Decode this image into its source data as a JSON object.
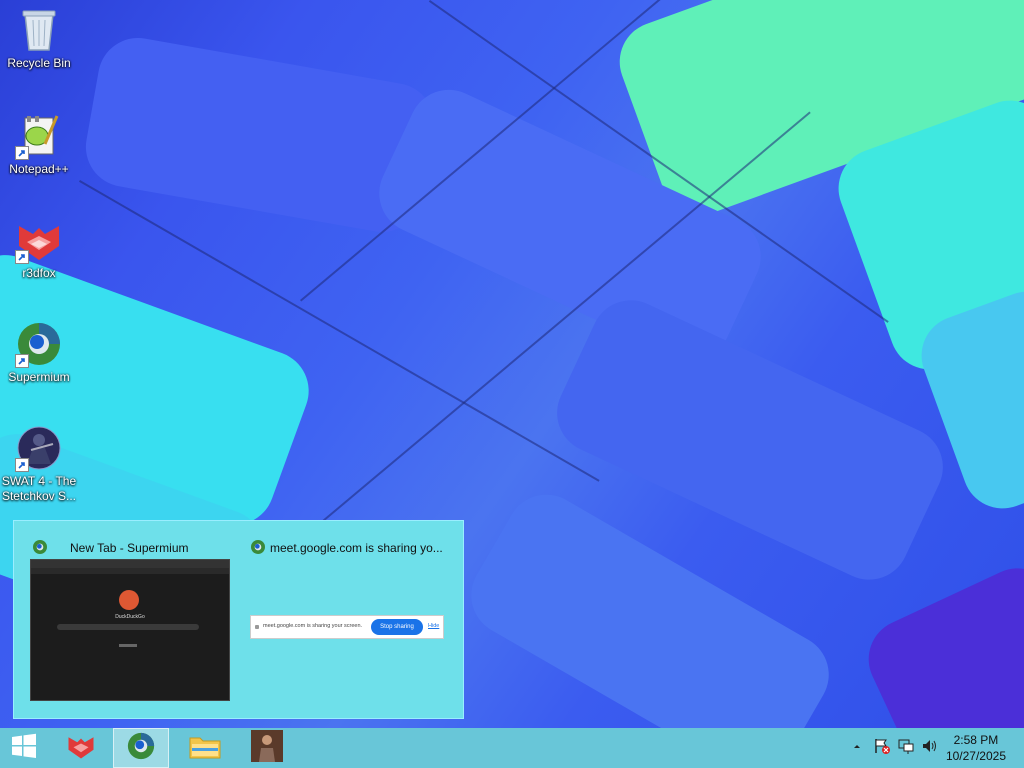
{
  "desktop_icons": [
    {
      "label": "Recycle Bin",
      "icon": "recycle-bin-icon"
    },
    {
      "label": "Notepad++",
      "icon": "notepadpp-icon"
    },
    {
      "label": "r3dfox",
      "icon": "r3dfox-icon"
    },
    {
      "label": "Supermium",
      "icon": "supermium-icon"
    },
    {
      "label": "SWAT 4 - The Stetchkov S...",
      "icon": "swat4-icon"
    }
  ],
  "popup": {
    "thumbnails": [
      {
        "title": "New Tab - Supermium",
        "icon": "supermium-icon",
        "preview": {
          "logo_text": "DuckDuckGo"
        }
      },
      {
        "title": "meet.google.com is sharing yo...",
        "icon": "supermium-icon",
        "preview": {
          "message": "meet.google.com is sharing your screen.",
          "stop_label": "Stop sharing",
          "hide_label": "Hide"
        }
      }
    ]
  },
  "taskbar": {
    "buttons": [
      {
        "name": "start-button",
        "icon": "windows-logo-icon"
      },
      {
        "name": "r3dfox",
        "icon": "r3dfox-icon"
      },
      {
        "name": "supermium",
        "icon": "supermium-icon",
        "active": true
      },
      {
        "name": "file-explorer",
        "icon": "folder-icon"
      },
      {
        "name": "swat4",
        "icon": "swat4-icon"
      }
    ],
    "tray": {
      "time": "2:58 PM",
      "date": "10/27/2025"
    }
  },
  "colors": {
    "taskbar": "#68c6d8",
    "popup": "#6ee0ea",
    "stop_button": "#1a73e8"
  }
}
